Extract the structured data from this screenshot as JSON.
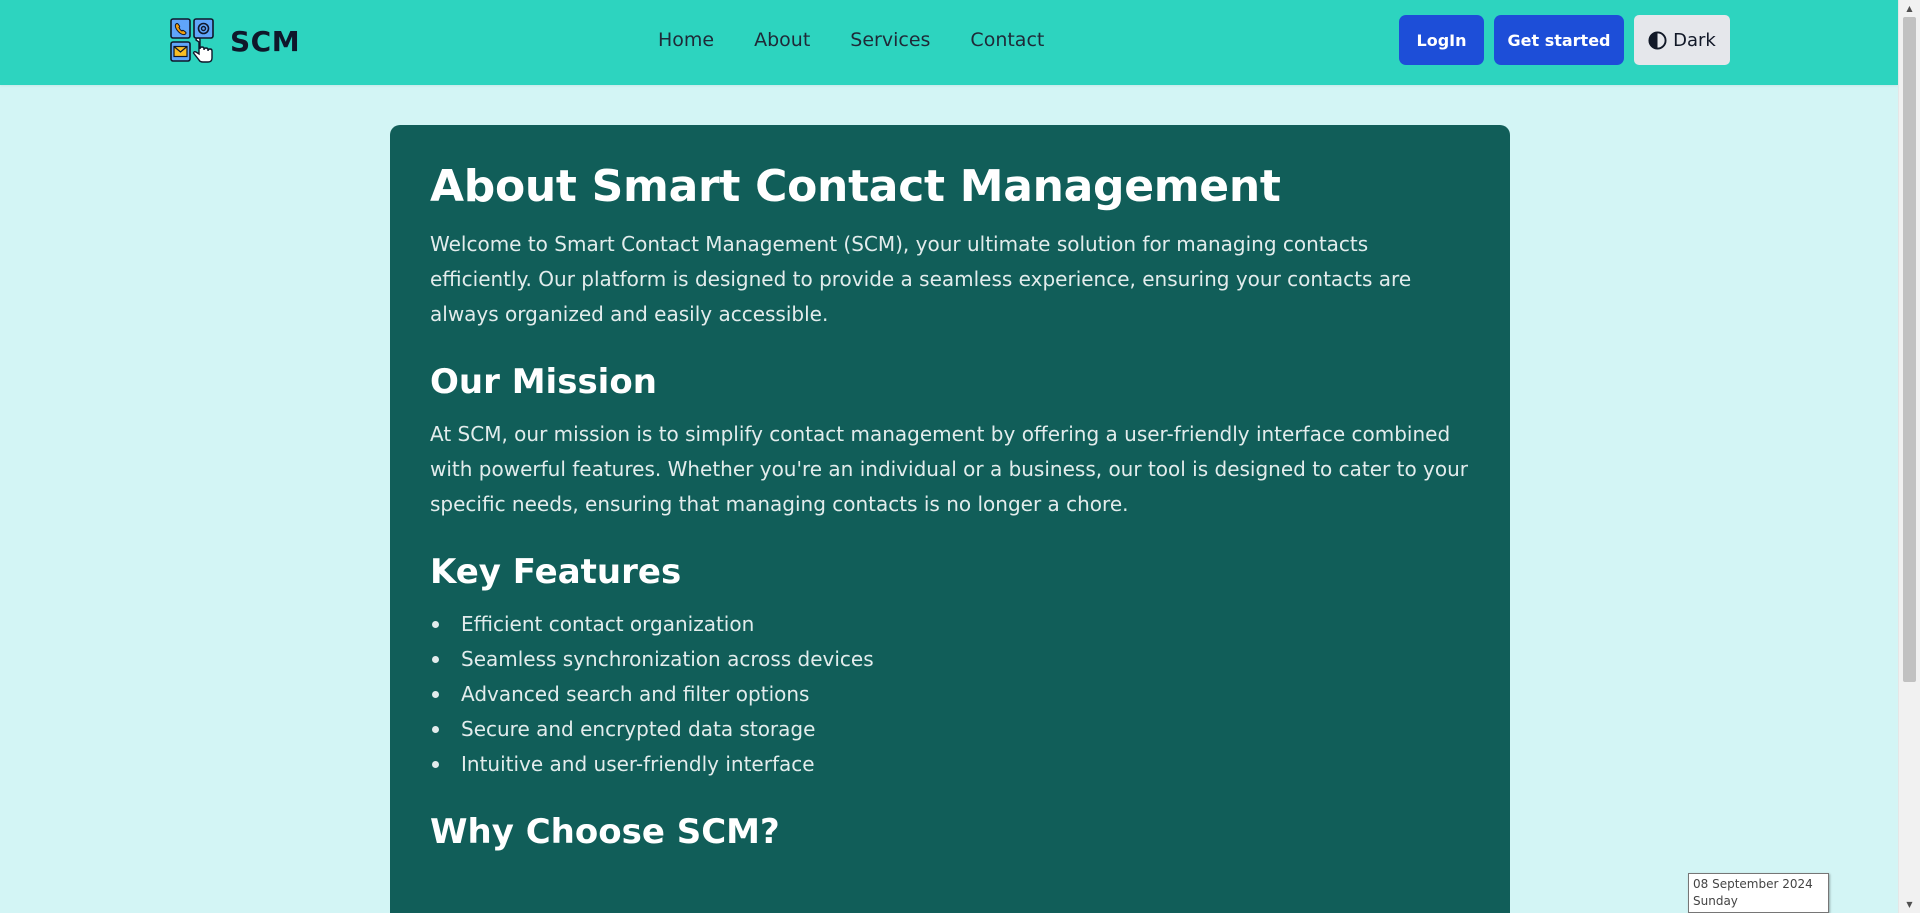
{
  "navbar": {
    "brand": "SCM",
    "links": [
      {
        "label": "Home"
      },
      {
        "label": "About"
      },
      {
        "label": "Services"
      },
      {
        "label": "Contact"
      }
    ],
    "login_label": "LogIn",
    "get_started_label": "Get started",
    "theme_label": "Dark"
  },
  "main": {
    "title": "About Smart Contact Management",
    "intro": "Welcome to Smart Contact Management (SCM), your ultimate solution for managing contacts efficiently. Our platform is designed to provide a seamless experience, ensuring your contacts are always organized and easily accessible.",
    "mission": {
      "heading": "Our Mission",
      "text": "At SCM, our mission is to simplify contact management by offering a user-friendly interface combined with powerful features. Whether you're an individual or a business, our tool is designed to cater to your specific needs, ensuring that managing contacts is no longer a chore."
    },
    "features": {
      "heading": "Key Features",
      "items": [
        "Efficient contact organization",
        "Seamless synchronization across devices",
        "Advanced search and filter options",
        "Secure and encrypted data storage",
        "Intuitive and user-friendly interface"
      ]
    },
    "why": {
      "heading": "Why Choose SCM?"
    }
  },
  "tooltip": {
    "date": "08 September 2024",
    "day": "Sunday"
  },
  "colors": {
    "navbar_bg": "#2dd4bf",
    "page_bg": "#d3f5f5",
    "card_bg": "#115e59",
    "primary_button": "#1d4ed8",
    "theme_button": "#e5e7eb"
  },
  "icons": {
    "logo": "contact-management-logo-icon",
    "theme": "half-circle-contrast-icon"
  }
}
